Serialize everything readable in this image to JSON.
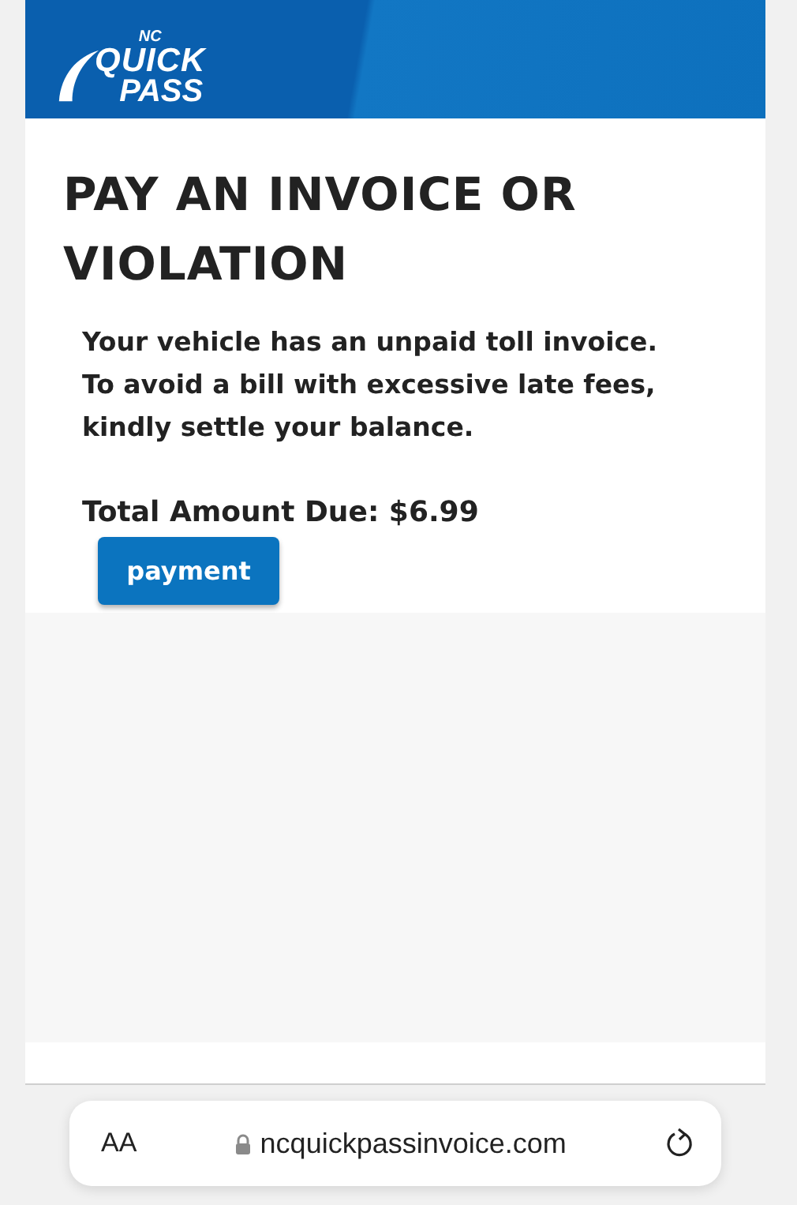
{
  "logo": {
    "lines": [
      "NC",
      "QUICK",
      "PASS"
    ]
  },
  "title": "PAY AN INVOICE OR VIOLATION",
  "message": "Your vehicle has an unpaid toll invoice. To avoid a bill with excessive late fees, kindly settle your balance.",
  "total": "Total Amount Due: $6.99",
  "button": "payment",
  "address_bar": {
    "text_size": "AA",
    "url": "ncquickpassinvoice.com",
    "secure": true
  }
}
